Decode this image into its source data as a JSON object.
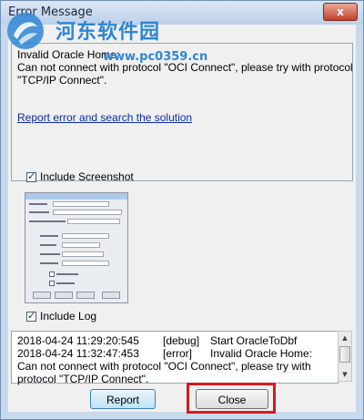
{
  "window": {
    "title": "Error Message",
    "close_glyph": "x"
  },
  "watermark": {
    "site_name": "河东软件园",
    "url": "www.pc0359.cn"
  },
  "message": {
    "lines": [
      "Invalid Oracle Home:",
      "Can not connect with protocol \"OCI Connect\", please try with protocol",
      "\"TCP/IP Connect\"."
    ],
    "report_link": "Report error and search the solution"
  },
  "include_screenshot": {
    "label": "Include Screenshot",
    "checked": true
  },
  "include_log": {
    "label": "Include Log",
    "checked": true
  },
  "log": {
    "entries": [
      {
        "time": "2018-04-24 11:29:20:545",
        "level": "[debug]",
        "message": "Start OracleToDbf"
      },
      {
        "time": "2018-04-24 11:32:47:453",
        "level": "[error]",
        "message": "Invalid Oracle Home:"
      }
    ],
    "continuation": [
      "Can not connect with protocol \"OCI Connect\", please try with",
      "protocol \"TCP/IP Connect\"."
    ]
  },
  "buttons": {
    "report": "Report",
    "close": "Close"
  },
  "colors": {
    "highlight": "#d61a1a",
    "link": "#0a2ba8",
    "watermark": "#2e86d6"
  }
}
